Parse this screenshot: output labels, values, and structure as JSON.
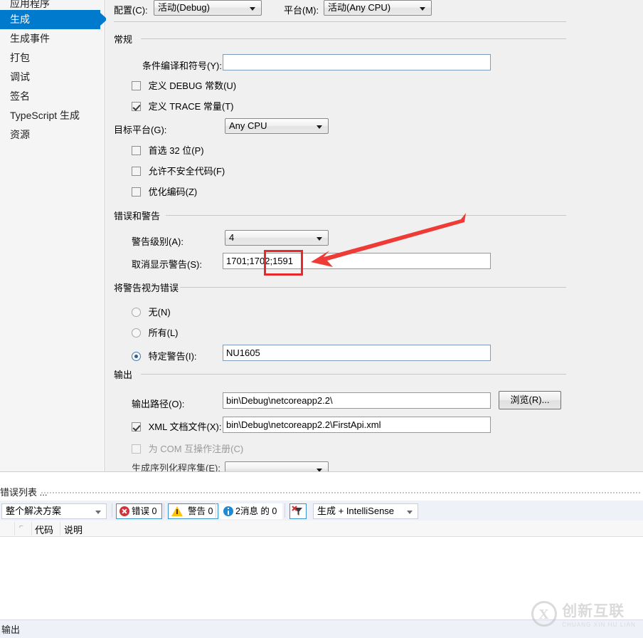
{
  "sidebar": {
    "items": [
      {
        "label": "应用程序",
        "selected": false,
        "cut": true
      },
      {
        "label": "生成",
        "selected": true
      },
      {
        "label": "生成事件",
        "selected": false
      },
      {
        "label": "打包",
        "selected": false
      },
      {
        "label": "调试",
        "selected": false
      },
      {
        "label": "签名",
        "selected": false
      },
      {
        "label": "TypeScript 生成",
        "selected": false
      },
      {
        "label": "资源",
        "selected": false
      }
    ]
  },
  "top": {
    "config_label": "配置(C):",
    "config_value": "活动(Debug)",
    "platform_label": "平台(M):",
    "platform_value": "活动(Any CPU)"
  },
  "general": {
    "group_title": "常规",
    "cond_symbols_label": "条件编译和符号(Y):",
    "cond_symbols_value": "",
    "define_debug_label": "定义 DEBUG 常数(U)",
    "define_debug_checked": false,
    "define_trace_label": "定义 TRACE 常量(T)",
    "define_trace_checked": true,
    "target_platform_label": "目标平台(G):",
    "target_platform_value": "Any CPU",
    "prefer32_label": "首选 32 位(P)",
    "prefer32_checked": false,
    "unsafe_label": "允许不安全代码(F)",
    "unsafe_checked": false,
    "optimize_label": "优化编码(Z)",
    "optimize_checked": false
  },
  "errors_warnings": {
    "group_title": "错误和警告",
    "warn_level_label": "警告级别(A):",
    "warn_level_value": "4",
    "suppress_label": "取消显示警告(S):",
    "suppress_value": "1701;1702;1591"
  },
  "warnings_as_errors": {
    "group_title": "将警告视为错误",
    "none_label": "无(N)",
    "all_label": "所有(L)",
    "specific_label": "特定警告(I):",
    "selected": "specific",
    "specific_value": "NU1605"
  },
  "output": {
    "group_title": "输出",
    "path_label": "输出路径(O):",
    "path_value": "bin\\Debug\\netcoreapp2.2\\",
    "browse_label": "浏览(R)...",
    "xmldoc_label": "XML 文档文件(X):",
    "xmldoc_checked": true,
    "xmldoc_value": "bin\\Debug\\netcoreapp2.2\\FirstApi.xml",
    "com_label": "为 COM 互操作注册(C)",
    "com_checked": false,
    "com_disabled": true
  },
  "error_list": {
    "title": "错误列表 ...",
    "scope_value": "整个解决方案",
    "errors_label": "错误 0",
    "warnings_label": "警告 0",
    "messages_label": "2消息 的 0",
    "filter_icon": "filter-clear-icon",
    "source_value": "生成 + IntelliSense",
    "columns": [
      "",
      "代码",
      "说明"
    ]
  },
  "output_tab": {
    "label": "输出"
  },
  "watermark": {
    "mark": "X",
    "line1": "创新互联",
    "line2": "CHUANG XIN HU LIAN"
  },
  "colors": {
    "accent": "#007acc",
    "annotation": "#e8282a"
  }
}
